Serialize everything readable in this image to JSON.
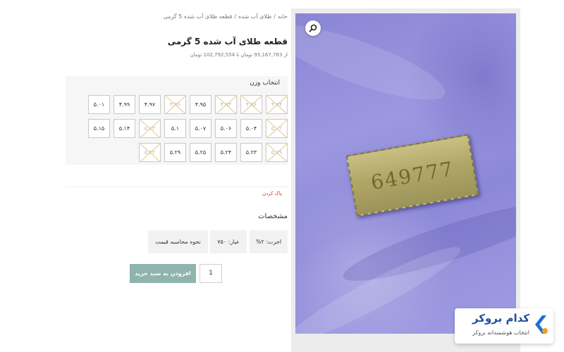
{
  "breadcrumb": {
    "home": "خانه",
    "category": "طلای آب شده",
    "current": "قطعه طلای آب شده 5 گرمی",
    "separator": "/"
  },
  "product": {
    "title": "قطعه طلای آب شده 5 گرمی",
    "price_range": "از 93,167,783 تومان تا 102,792,554 تومان"
  },
  "weight_selector": {
    "label": "انتخاب وزن",
    "rows": [
      [
        {
          "value": "۴.۹۴",
          "available": false
        },
        {
          "value": "۴.۹۶",
          "available": false
        },
        {
          "value": "۴.۹۳",
          "available": false
        },
        {
          "value": "۴.۹۵",
          "available": true
        },
        {
          "value": "۴.۹۶",
          "available": false
        },
        {
          "value": "۴.۹۷",
          "available": true
        },
        {
          "value": "۴.۹۹",
          "available": true
        },
        {
          "value": "۵.۰۱",
          "available": true
        }
      ],
      [
        {
          "value": "۵.۰۲",
          "available": false
        },
        {
          "value": "۵.۰۴",
          "available": true
        },
        {
          "value": "۵.۰۶",
          "available": true
        },
        {
          "value": "۵.۰۷",
          "available": true
        },
        {
          "value": "۵.۱",
          "available": true
        },
        {
          "value": "۵.۱۳",
          "available": false
        },
        {
          "value": "۵.۱۴",
          "available": true
        },
        {
          "value": "۵.۱۵",
          "available": true
        }
      ],
      [
        {
          "value": "۵.۱۹",
          "available": false
        },
        {
          "value": "۵.۲۳",
          "available": true
        },
        {
          "value": "۵.۲۴",
          "available": true
        },
        {
          "value": "۵.۲۵",
          "available": true
        },
        {
          "value": "۵.۲۹",
          "available": true
        },
        {
          "value": "۵.۳۲",
          "available": false
        }
      ]
    ],
    "clear_label": "پاک کردن"
  },
  "specs": {
    "title": "مشخصات",
    "items": [
      "اجرت: ۲%",
      "عیار: ۷۵۰",
      "نحوه محاسبه قیمت"
    ]
  },
  "cart": {
    "quantity": "1",
    "add_label": "افزودن به سبد خرید"
  },
  "image": {
    "tag_text": "649777",
    "zoom_icon": "magnifier-icon"
  },
  "brand": {
    "name": "کدام بروکر",
    "tagline": "انتخاب هوشمندانه بروکر",
    "accent": "#1f6fd6"
  }
}
